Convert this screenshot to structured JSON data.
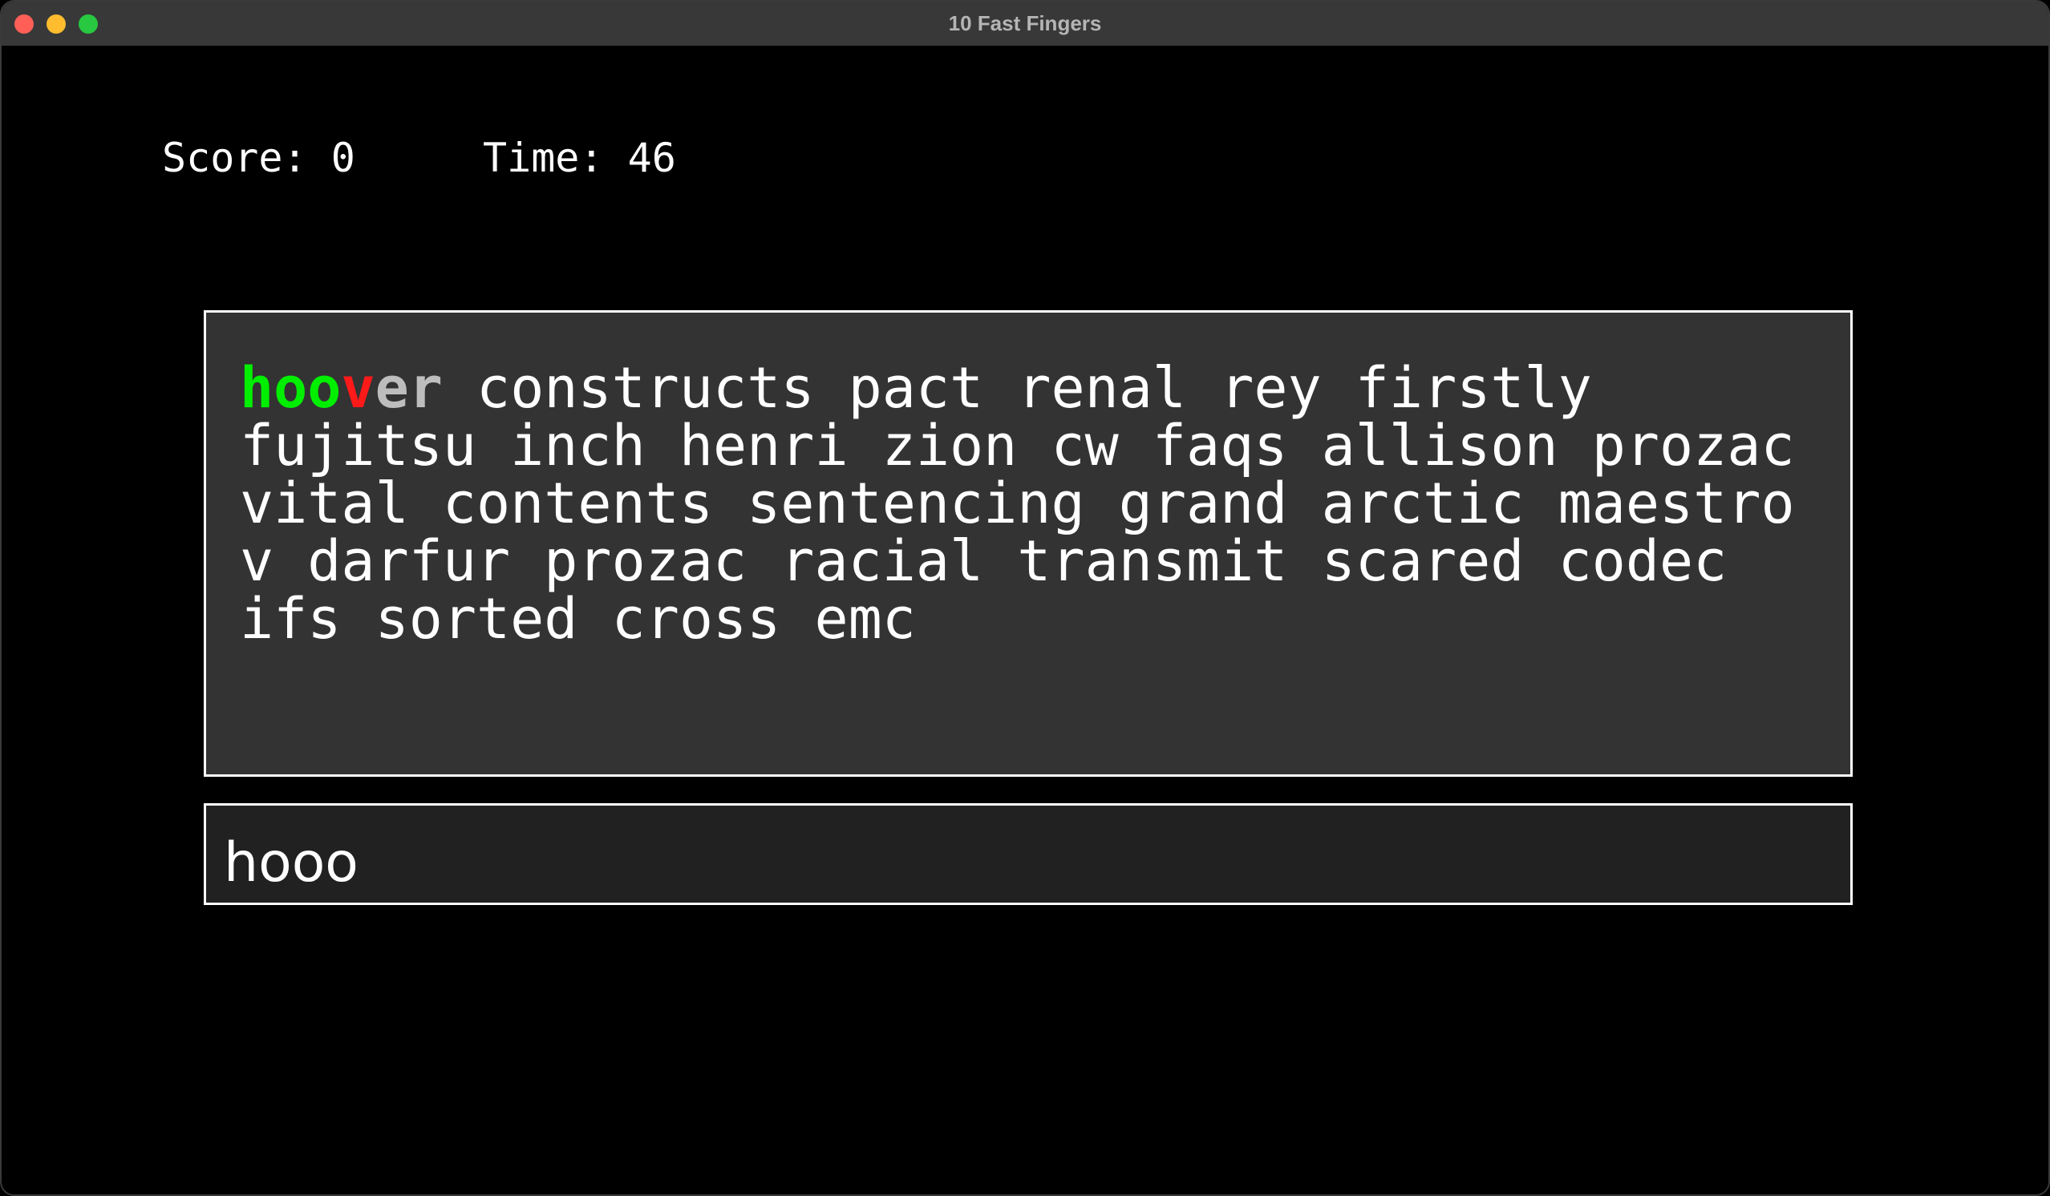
{
  "window": {
    "title": "10 Fast Fingers"
  },
  "hud": {
    "score_text": "Score: 0",
    "time_text": "Time: 46"
  },
  "current_word": {
    "correct": "hoo",
    "wrong": "v",
    "pending": "er"
  },
  "remaining_words": "constructs pact renal rey firstly fujitsu inch henri zion cw faqs allison prozac vital contents sentencing grand arctic maestro v darfur prozac racial transmit scared codec ifs sorted cross emc",
  "input": {
    "value": "hooo"
  },
  "colors": {
    "correct": "#00ee00",
    "wrong": "#ff1a1a",
    "pending": "#bdbdbd",
    "word_box_bg": "#333333",
    "input_box_bg": "#212121"
  }
}
